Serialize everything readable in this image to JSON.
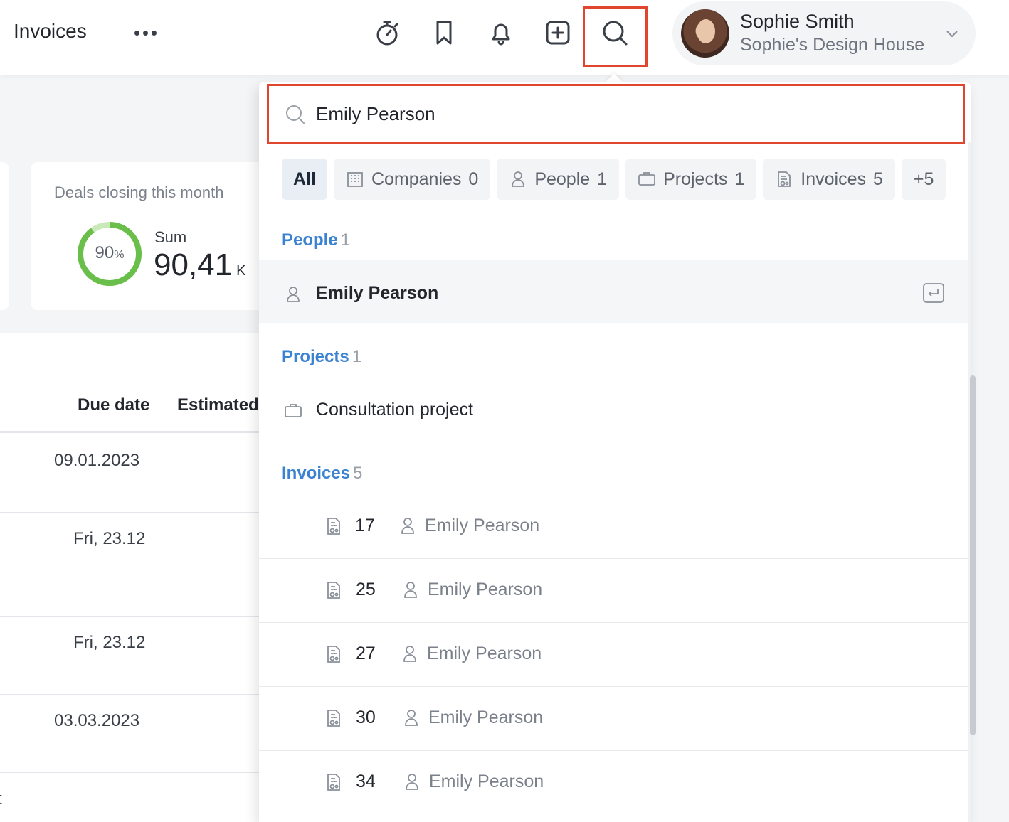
{
  "app": {
    "title": "Invoices"
  },
  "topbar": {
    "icons": [
      "stopwatch-icon",
      "bookmark-icon",
      "bell-icon",
      "add-square-icon",
      "search-icon"
    ],
    "user": {
      "name": "Sophie Smith",
      "organization": "Sophie's Design House"
    }
  },
  "dashboard": {
    "card": {
      "title": "Deals closing this month",
      "percent": "90",
      "percent_sign": "%",
      "percent_value": 90,
      "sum_label": "Sum",
      "sum_value": "90,41",
      "sum_suffix": "K"
    },
    "table": {
      "headers": [
        "Due date",
        "Estimated"
      ],
      "due_dates": [
        "09.01.2023",
        "Fri, 23.12",
        "Fri, 23.12",
        "03.03.2023"
      ],
      "trailing_text": "t"
    }
  },
  "search": {
    "query": "Emily Pearson",
    "filters": [
      {
        "label": "All",
        "count": "",
        "icon": ""
      },
      {
        "label": "Companies",
        "count": "0",
        "icon": "building-icon"
      },
      {
        "label": "People",
        "count": "1",
        "icon": "person-icon"
      },
      {
        "label": "Projects",
        "count": "1",
        "icon": "briefcase-icon"
      },
      {
        "label": "Invoices",
        "count": "5",
        "icon": "invoice-icon"
      },
      {
        "label": "+5",
        "count": "",
        "icon": ""
      }
    ],
    "sections": {
      "people": {
        "title": "People",
        "count": "1",
        "results": [
          "Emily Pearson"
        ]
      },
      "projects": {
        "title": "Projects",
        "count": "1",
        "results": [
          "Consultation project"
        ]
      },
      "invoices": {
        "title": "Invoices",
        "count": "5",
        "results": [
          {
            "number": "17",
            "person": "Emily Pearson"
          },
          {
            "number": "25",
            "person": "Emily Pearson"
          },
          {
            "number": "27",
            "person": "Emily Pearson"
          },
          {
            "number": "30",
            "person": "Emily Pearson"
          },
          {
            "number": "34",
            "person": "Emily Pearson"
          }
        ]
      }
    }
  },
  "colors": {
    "accent": "#3b82d1",
    "highlight_border": "#e0452d",
    "progress": "#6abf4b"
  }
}
